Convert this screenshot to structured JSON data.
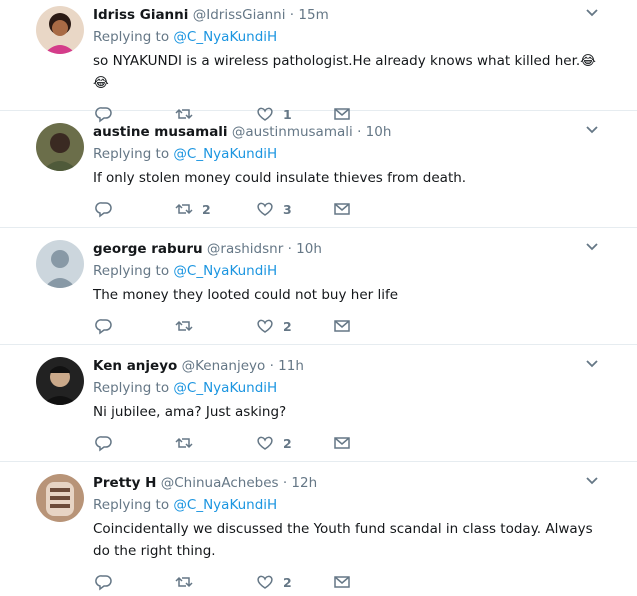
{
  "tweets": [
    {
      "name": "Idriss Gianni",
      "handle": "@IdrissGianni",
      "time": "15m",
      "replying_label": "Replying to",
      "replying_to": "@C_NyaKundiH",
      "text": "so NYAKUNDI is a wireless pathologist.He already knows what killed her.😂😂",
      "retweets": "",
      "likes": "1"
    },
    {
      "name": "austine musamali",
      "handle": "@austinmusamali",
      "time": "10h",
      "replying_label": "Replying to",
      "replying_to": "@C_NyaKundiH",
      "text": "If only stolen money could insulate thieves from death.",
      "retweets": "2",
      "likes": "3"
    },
    {
      "name": "george raburu",
      "handle": "@rashidsnr",
      "time": "10h",
      "replying_label": "Replying to",
      "replying_to": "@C_NyaKundiH",
      "text": "The money they looted could not buy her life",
      "retweets": "",
      "likes": "2"
    },
    {
      "name": "Ken anjeyo",
      "handle": "@Kenanjeyo",
      "time": "11h",
      "replying_label": "Replying to",
      "replying_to": "@C_NyaKundiH",
      "text": "Ni jubilee, ama?  Just asking?",
      "retweets": "",
      "likes": "2"
    },
    {
      "name": "Pretty H",
      "handle": "@ChinuaAchebes",
      "time": "12h",
      "replying_label": "Replying to",
      "replying_to": "@C_NyaKundiH",
      "text": "Coincidentally we discussed the Youth fund scandal in class today. Always do the right thing.",
      "retweets": "",
      "likes": "2"
    }
  ],
  "dot": "·",
  "colors": {
    "link": "#1b95e0",
    "muted": "#657786",
    "divider": "#e6ecf0"
  }
}
